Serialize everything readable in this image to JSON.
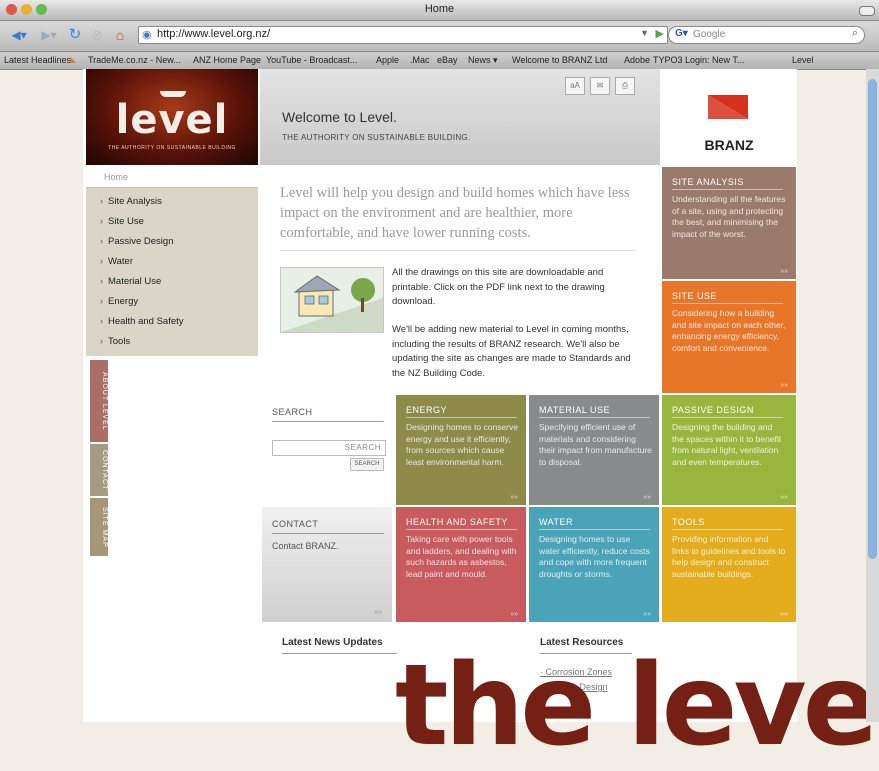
{
  "window": {
    "title": "Home"
  },
  "toolbar": {
    "url": "http://www.level.org.nz/",
    "search_placeholder": "Google"
  },
  "bookmarks": [
    "Latest Headlines",
    "TradeMe.co.nz - New...",
    "ANZ Home Page",
    "YouTube - Broadcast...",
    "Apple",
    ".Mac",
    "eBay",
    "News ▾",
    "Welcome to BRANZ Ltd",
    "Adobe",
    "TYPO3 Login: New T...",
    "Level"
  ],
  "header": {
    "logo_word": "level",
    "logo_tagline": "THE AUTHORITY ON SUSTAINABLE BUILDING",
    "welcome": "Welcome to Level.",
    "subtitle": "THE AUTHORITY ON SUSTAINABLE BUILDING.",
    "branz": "BRANZ"
  },
  "nav": {
    "home": "Home",
    "items": [
      "Site Analysis",
      "Site Use",
      "Passive Design",
      "Water",
      "Material Use",
      "Energy",
      "Health and Safety",
      "Tools"
    ],
    "side_tabs": [
      "ABOUT LEVEL",
      "CONTACT",
      "SITE MAP"
    ]
  },
  "content": {
    "intro": "Level will help you design and build homes which have less impact on the environment and are healthier, more comfortable, and have lower running costs.",
    "p1": "All the drawings on this site are downloadable and printable. Click on the PDF link next to the drawing download.",
    "p2": "We'll be adding new material to Level in coming months, including the results of BRANZ research. We'll also be updating the site as changes are made to Standards and the NZ Building Code."
  },
  "search": {
    "title": "SEARCH",
    "input_label": "SEARCH",
    "button": "SEARCH"
  },
  "contact": {
    "title": "CONTACT",
    "text": "Contact BRANZ."
  },
  "tiles": [
    {
      "title": "SITE ANALYSIS",
      "text": "Understanding all the features of a site, using and protecting the best, and minimising the impact of the worst.",
      "color": "#9a7b6b"
    },
    {
      "title": "SITE USE",
      "text": "Considering how a building and site impact on each other, enhancing energy efficiency, comfort and convenience.",
      "color": "#e8762a"
    },
    {
      "title": "ENERGY",
      "text": "Designing homes to conserve energy and use it efficiently, from sources which cause least environmental harm.",
      "color": "#8d8a4a"
    },
    {
      "title": "MATERIAL USE",
      "text": "Specifying efficient use of materials and considering their impact from manufacture to disposal.",
      "color": "#888a8c"
    },
    {
      "title": "PASSIVE DESIGN",
      "text": "Designing the building and the spaces within it to benefit from natural light, ventilation and even temperatures.",
      "color": "#98b63e"
    },
    {
      "title": "HEALTH AND SAFETY",
      "text": "Taking care with power tools and ladders, and dealing with such hazards as asbestos, lead paint and mould.",
      "color": "#c75b5e"
    },
    {
      "title": "WATER",
      "text": "Designing homes to use water efficiently, reduce costs and cope with more frequent droughts or storms.",
      "color": "#4aa3b6"
    },
    {
      "title": "TOOLS",
      "text": "Providing information and links to guidelines and tools to help design and construct sustainable buildings.",
      "color": "#e2ac1c"
    }
  ],
  "footer": {
    "news": "Latest News Updates",
    "resources": "Latest Resources",
    "res_links": [
      "Corrosion Zones",
      "Passive Design"
    ]
  },
  "overlay_text": "the leve",
  "more_marker": "»»"
}
